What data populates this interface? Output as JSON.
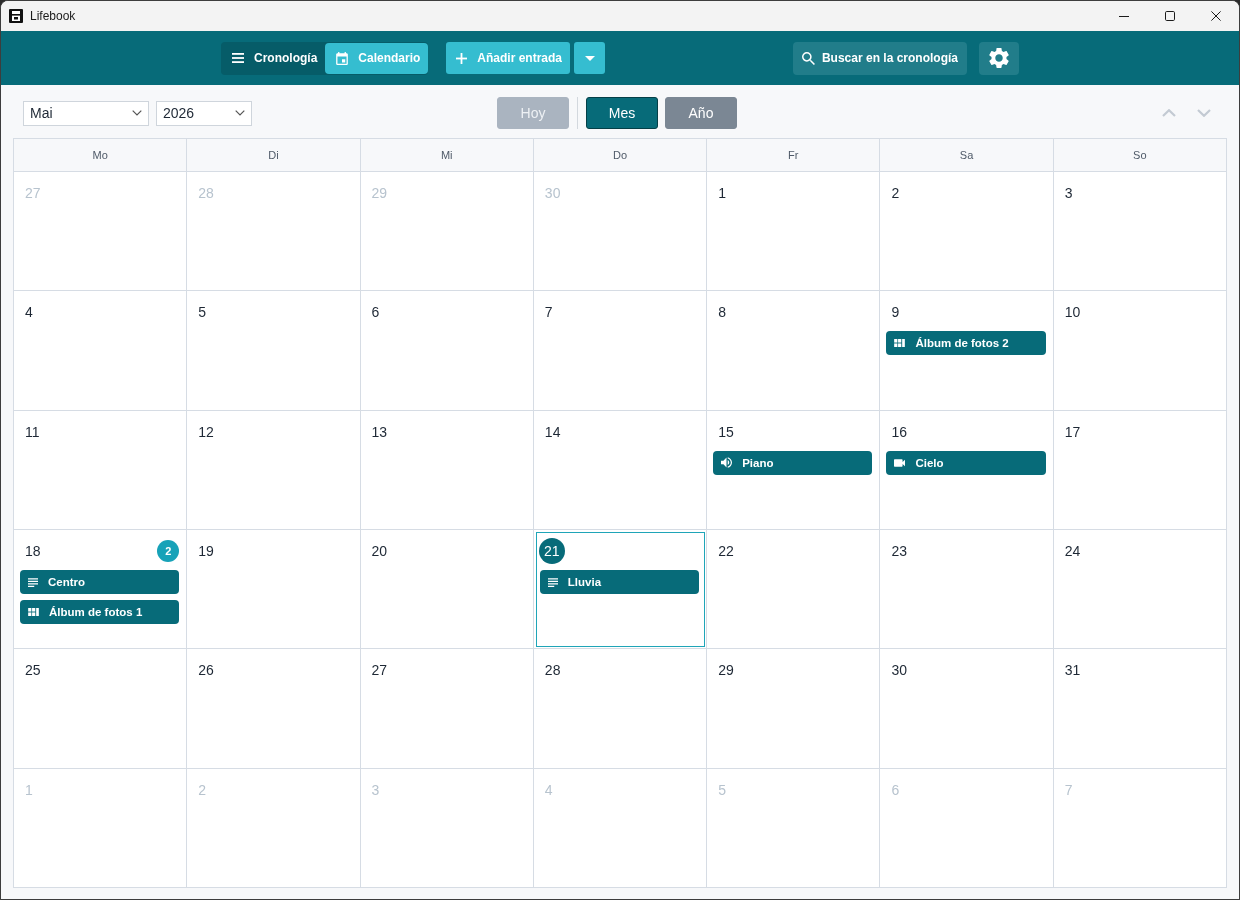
{
  "window": {
    "title": "Lifebook"
  },
  "toolbar": {
    "view_tabs": [
      {
        "label": "Cronología",
        "kind": "timeline",
        "selected": false
      },
      {
        "label": "Calendario",
        "kind": "calendar",
        "selected": true
      }
    ],
    "add_button": {
      "label": "Añadir entrada"
    },
    "search_button": {
      "label": "Buscar en la cronología"
    }
  },
  "period": {
    "month": "Mai",
    "year": "2026"
  },
  "view_buttons": [
    {
      "label": "Hoy",
      "selected": false,
      "disabled": true
    },
    {
      "label": "Mes",
      "selected": true,
      "disabled": false
    },
    {
      "label": "Año",
      "selected": false,
      "disabled": false
    }
  ],
  "calendar": {
    "weekdays": [
      "Mo",
      "Di",
      "Mi",
      "Do",
      "Fr",
      "Sa",
      "So"
    ],
    "weeks": [
      [
        {
          "day": "27",
          "outside": true,
          "today": false,
          "selected": false
        },
        {
          "day": "28",
          "outside": true,
          "today": false,
          "selected": false
        },
        {
          "day": "29",
          "outside": true,
          "today": false,
          "selected": false
        },
        {
          "day": "30",
          "outside": true,
          "today": false,
          "selected": false
        },
        {
          "day": "1",
          "outside": false,
          "today": false,
          "selected": false
        },
        {
          "day": "2",
          "outside": false,
          "today": false,
          "selected": false
        },
        {
          "day": "3",
          "outside": false,
          "today": false,
          "selected": false
        }
      ],
      [
        {
          "day": "4",
          "outside": false,
          "today": false,
          "selected": false
        },
        {
          "day": "5",
          "outside": false,
          "today": false,
          "selected": false
        },
        {
          "day": "6",
          "outside": false,
          "today": false,
          "selected": false
        },
        {
          "day": "7",
          "outside": false,
          "today": false,
          "selected": false
        },
        {
          "day": "8",
          "outside": false,
          "today": false,
          "selected": false
        },
        {
          "day": "9",
          "outside": false,
          "today": false,
          "selected": false,
          "events": [
            {
              "label": "Álbum de fotos 2",
              "kind": "album"
            }
          ]
        },
        {
          "day": "10",
          "outside": false,
          "today": false,
          "selected": false
        }
      ],
      [
        {
          "day": "11",
          "outside": false,
          "today": false,
          "selected": false
        },
        {
          "day": "12",
          "outside": false,
          "today": false,
          "selected": false
        },
        {
          "day": "13",
          "outside": false,
          "today": false,
          "selected": false
        },
        {
          "day": "14",
          "outside": false,
          "today": false,
          "selected": false
        },
        {
          "day": "15",
          "outside": false,
          "today": false,
          "selected": false,
          "events": [
            {
              "label": "Piano",
              "kind": "audio"
            }
          ]
        },
        {
          "day": "16",
          "outside": false,
          "today": false,
          "selected": false,
          "events": [
            {
              "label": "Cielo",
              "kind": "video"
            }
          ]
        },
        {
          "day": "17",
          "outside": false,
          "today": false,
          "selected": false
        }
      ],
      [
        {
          "day": "18",
          "outside": false,
          "today": false,
          "selected": false,
          "badge": "2",
          "events": [
            {
              "label": "Centro",
              "kind": "text"
            },
            {
              "label": "Álbum de fotos 1",
              "kind": "album"
            }
          ]
        },
        {
          "day": "19",
          "outside": false,
          "today": false,
          "selected": false
        },
        {
          "day": "20",
          "outside": false,
          "today": false,
          "selected": false
        },
        {
          "day": "21",
          "outside": false,
          "today": true,
          "selected": true,
          "events": [
            {
              "label": "Lluvia",
              "kind": "text"
            }
          ]
        },
        {
          "day": "22",
          "outside": false,
          "today": false,
          "selected": false
        },
        {
          "day": "23",
          "outside": false,
          "today": false,
          "selected": false
        },
        {
          "day": "24",
          "outside": false,
          "today": false,
          "selected": false
        }
      ],
      [
        {
          "day": "25",
          "outside": false,
          "today": false,
          "selected": false
        },
        {
          "day": "26",
          "outside": false,
          "today": false,
          "selected": false
        },
        {
          "day": "27",
          "outside": false,
          "today": false,
          "selected": false
        },
        {
          "day": "28",
          "outside": false,
          "today": false,
          "selected": false
        },
        {
          "day": "29",
          "outside": false,
          "today": false,
          "selected": false
        },
        {
          "day": "30",
          "outside": false,
          "today": false,
          "selected": false
        },
        {
          "day": "31",
          "outside": false,
          "today": false,
          "selected": false
        }
      ],
      [
        {
          "day": "1",
          "outside": true,
          "today": false,
          "selected": false
        },
        {
          "day": "2",
          "outside": true,
          "today": false,
          "selected": false
        },
        {
          "day": "3",
          "outside": true,
          "today": false,
          "selected": false
        },
        {
          "day": "4",
          "outside": true,
          "today": false,
          "selected": false
        },
        {
          "day": "5",
          "outside": true,
          "today": false,
          "selected": false
        },
        {
          "day": "6",
          "outside": true,
          "today": false,
          "selected": false
        },
        {
          "day": "7",
          "outside": true,
          "today": false,
          "selected": false
        }
      ]
    ]
  }
}
